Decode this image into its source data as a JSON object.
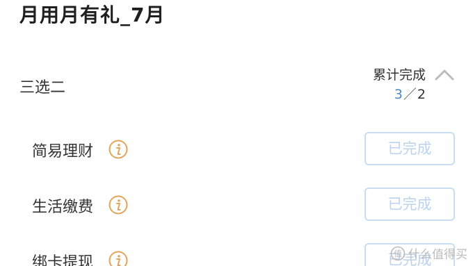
{
  "header": {
    "title": "月用月有礼_7月"
  },
  "section": {
    "label": "三选二",
    "progress_title": "累计完成",
    "progress_done": "3",
    "progress_separator": "／",
    "progress_total": "2",
    "toggle_icon": "chevron-up-icon"
  },
  "tasks": [
    {
      "name": "简易理财",
      "info_icon": "info-icon",
      "button_label": "已完成"
    },
    {
      "name": "生活缴费",
      "info_icon": "info-icon",
      "button_label": "已完成"
    },
    {
      "name": "绑卡提现",
      "info_icon": "info-icon",
      "button_label": "已完成"
    }
  ],
  "watermark": {
    "text": "什么值得买"
  },
  "colors": {
    "accent_blue": "#4d88c5",
    "info_orange": "#e0a55a",
    "button_border": "#c9ddf2",
    "button_text": "#bcd2ec"
  }
}
